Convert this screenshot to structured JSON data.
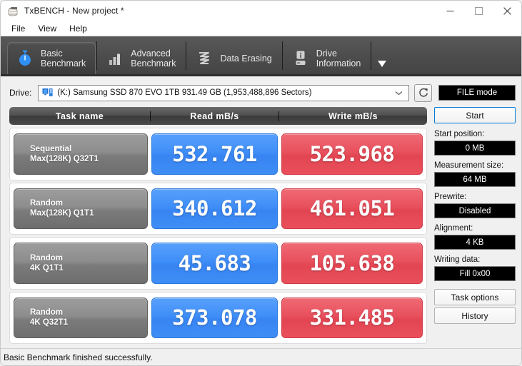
{
  "window": {
    "title": "TxBENCH - New project *",
    "icon": "app-icon",
    "controls": {
      "minimize": "minimize-icon",
      "maximize": "maximize-icon",
      "close": "close-icon"
    }
  },
  "menu": {
    "items": [
      {
        "label": "File"
      },
      {
        "label": "View"
      },
      {
        "label": "Help"
      }
    ]
  },
  "tabs": {
    "overflow_icon": "chevron-down-icon",
    "items": [
      {
        "line1": "Basic",
        "line2": "Benchmark",
        "icon": "stopwatch-icon",
        "active": true
      },
      {
        "line1": "Advanced",
        "line2": "Benchmark",
        "icon": "bar-chart-icon",
        "active": false
      },
      {
        "line1": "Data Erasing",
        "line2": "",
        "icon": "shredder-icon",
        "active": false
      },
      {
        "line1": "Drive",
        "line2": "Information",
        "icon": "drive-info-icon",
        "active": false
      }
    ]
  },
  "drive": {
    "label": "Drive:",
    "icon": "drive-icon",
    "value": "(K:) Samsung SSD 870 EVO 1TB  931.49 GB (1,953,488,896 Sectors)",
    "dropdown_icon": "chevron-down-icon",
    "refresh_icon": "refresh-icon",
    "mode_badge": "FILE mode"
  },
  "table": {
    "headers": {
      "task": "Task name",
      "read": "Read mB/s",
      "write": "Write mB/s"
    },
    "rows": [
      {
        "task_l1": "Sequential",
        "task_l2": "Max(128K) Q32T1",
        "read": "532.761",
        "write": "523.968"
      },
      {
        "task_l1": "Random",
        "task_l2": "Max(128K) Q1T1",
        "read": "340.612",
        "write": "461.051"
      },
      {
        "task_l1": "Random",
        "task_l2": "4K Q1T1",
        "read": "45.683",
        "write": "105.638"
      },
      {
        "task_l1": "Random",
        "task_l2": "4K Q32T1",
        "read": "373.078",
        "write": "331.485"
      }
    ]
  },
  "sidebar": {
    "start_label": "Start",
    "fields": [
      {
        "label": "Start position:",
        "value": "0 MB"
      },
      {
        "label": "Measurement size:",
        "value": "64 MB"
      },
      {
        "label": "Prewrite:",
        "value": "Disabled"
      },
      {
        "label": "Alignment:",
        "value": "4 KB"
      },
      {
        "label": "Writing data:",
        "value": "Fill 0x00"
      }
    ],
    "task_options_label": "Task options",
    "history_label": "History"
  },
  "status": {
    "text": "Basic Benchmark finished successfully."
  },
  "colors": {
    "read": "#3f8ef8",
    "write": "#e8505d",
    "accent": "#0a7bd4",
    "tabstrip": "#4c4c4c"
  }
}
